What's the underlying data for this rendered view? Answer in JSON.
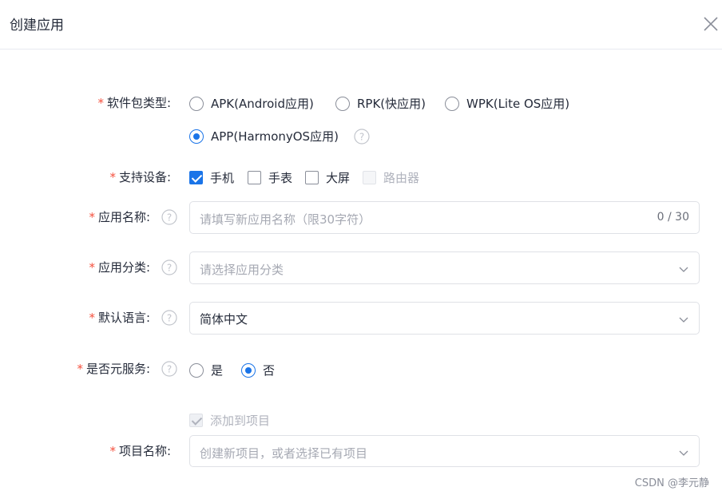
{
  "dialog": {
    "title": "创建应用",
    "close_icon": "close-icon"
  },
  "form": {
    "package_type": {
      "label": "软件包类型:",
      "options": [
        {
          "label": "APK(Android应用)",
          "checked": false
        },
        {
          "label": "RPK(快应用)",
          "checked": false
        },
        {
          "label": "WPK(Lite OS应用)",
          "checked": false
        },
        {
          "label": "APP(HarmonyOS应用)",
          "checked": true
        }
      ]
    },
    "devices": {
      "label": "支持设备:",
      "options": [
        {
          "label": "手机",
          "checked": true,
          "disabled": false
        },
        {
          "label": "手表",
          "checked": false,
          "disabled": false
        },
        {
          "label": "大屏",
          "checked": false,
          "disabled": false
        },
        {
          "label": "路由器",
          "checked": false,
          "disabled": true
        }
      ]
    },
    "app_name": {
      "label": "应用名称:",
      "placeholder": "请填写新应用名称（限30字符）",
      "counter": "0 / 30"
    },
    "app_category": {
      "label": "应用分类:",
      "placeholder": "请选择应用分类"
    },
    "default_language": {
      "label": "默认语言:",
      "value": "简体中文"
    },
    "meta_service": {
      "label": "是否元服务:",
      "options": [
        {
          "label": "是",
          "checked": false
        },
        {
          "label": "否",
          "checked": true
        }
      ]
    },
    "add_to_project": {
      "label": "添加到项目",
      "checked": true,
      "disabled": true
    },
    "project_name": {
      "label": "项目名称:",
      "placeholder": "创建新项目，或者选择已有项目"
    },
    "required_mark": "*"
  },
  "watermark": "CSDN @李元静",
  "colors": {
    "primary": "#1a74e8",
    "required": "#f5503d",
    "border": "#dfe1e6",
    "placeholder": "#a6a9b3"
  }
}
